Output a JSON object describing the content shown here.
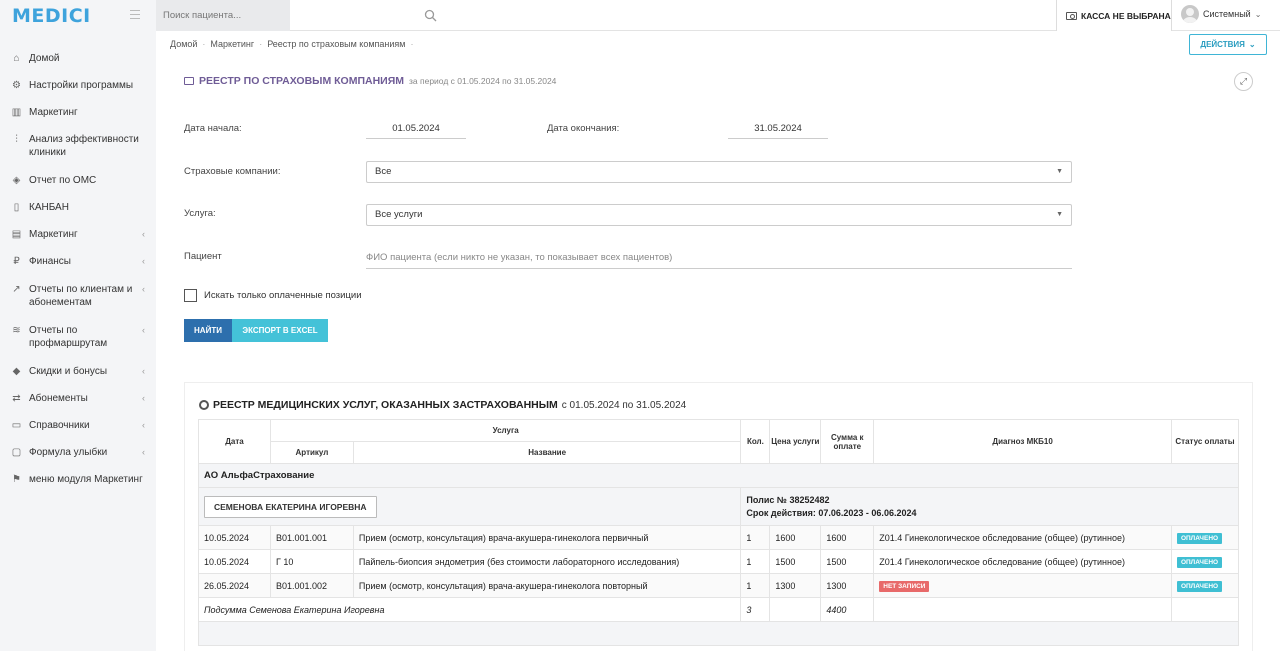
{
  "app": {
    "logo": "MEDICI"
  },
  "search": {
    "placeholder": "Поиск пациента..."
  },
  "kassa": {
    "label": "КАССА НЕ ВЫБРАНА"
  },
  "user": {
    "name": "Системный"
  },
  "sidebar": {
    "items": [
      {
        "label": "Домой",
        "icon": "home-icon",
        "arrow": false
      },
      {
        "label": "Настройки программы",
        "icon": "gear-icon",
        "arrow": false
      },
      {
        "label": "Маркетинг",
        "icon": "chart-icon",
        "arrow": false
      },
      {
        "label": "Анализ эффективности клиники",
        "icon": "sliders-icon",
        "arrow": false
      },
      {
        "label": "Отчет по ОМС",
        "icon": "shield-icon",
        "arrow": false
      },
      {
        "label": "КАНБАН",
        "icon": "columns-icon",
        "arrow": false
      },
      {
        "label": "Маркетинг",
        "icon": "bar-chart-icon",
        "arrow": true
      },
      {
        "label": "Финансы",
        "icon": "ruble-icon",
        "arrow": true
      },
      {
        "label": "Отчеты по клиентам и абонементам",
        "icon": "line-chart-icon",
        "arrow": true
      },
      {
        "label": "Отчеты по профмаршрутам",
        "icon": "layers-icon",
        "arrow": true
      },
      {
        "label": "Скидки и бонусы",
        "icon": "tag-icon",
        "arrow": true
      },
      {
        "label": "Абонементы",
        "icon": "ticket-icon",
        "arrow": true
      },
      {
        "label": "Справочники",
        "icon": "book-icon",
        "arrow": true
      },
      {
        "label": "Формула улыбки",
        "icon": "chat-icon",
        "arrow": true
      },
      {
        "label": "меню модуля Маркетинг",
        "icon": "signpost-icon",
        "arrow": false
      }
    ]
  },
  "breadcrumb": {
    "home": "Домой",
    "marketing": "Маркетинг",
    "current": "Реестр по страховым компаниям"
  },
  "actions": {
    "label": "ДЕЙСТВИЯ"
  },
  "panel": {
    "title": "РЕЕСТР ПО СТРАХОВЫМ КОМПАНИЯМ",
    "subtitle": "за период с 01.05.2024 по 31.05.2024"
  },
  "form": {
    "start_label": "Дата начала:",
    "start_value": "01.05.2024",
    "end_label": "Дата окончания:",
    "end_value": "31.05.2024",
    "insurers_label": "Страховые компании:",
    "insurers_value": "Все",
    "service_label": "Услуга:",
    "service_value": "Все услуги",
    "patient_label": "Пациент",
    "patient_placeholder": "ФИО пациента (если никто не указан, то показывает всех пациентов)",
    "paid_only_label": "Искать только оплаченные позиции",
    "find_button": "НАЙТИ",
    "excel_button": "ЭКСПОРТ В EXCEL"
  },
  "report": {
    "title": "РЕЕСТР МЕДИЦИНСКИХ УСЛУГ, ОКАЗАННЫХ ЗАСТРАХОВАННЫМ",
    "period": "с 01.05.2024 по 31.05.2024",
    "headers": {
      "date": "Дата",
      "service": "Услуга",
      "article": "Артикул",
      "name": "Название",
      "qty": "Кол.",
      "price": "Цена услуги",
      "sum": "Сумма к оплате",
      "diagnosis": "Диагноз МКБ10",
      "status": "Статус оплаты"
    },
    "company": "АО АльфаСтрахование",
    "patient": {
      "name": "СЕМЕНОВА ЕКАТЕРИНА ИГОРЕВНА",
      "polis": "Полис № 38252482",
      "validity": "Срок действия: 07.06.2023 - 06.06.2024"
    },
    "rows": [
      {
        "date": "10.05.2024",
        "article": "B01.001.001",
        "name": "Прием (осмотр, консультация) врача-акушера-гинеколога первичный",
        "qty": "1",
        "price": "1600",
        "sum": "1600",
        "diagnosis": "Z01.4 Гинекологическое обследование (общее) (рутинное)",
        "diag_badge": "",
        "status": "ОПЛАЧЕНО"
      },
      {
        "date": "10.05.2024",
        "article": "Г 10",
        "name": "Пайпель-биопсия эндометрия (без стоимости лабораторного исследования)",
        "qty": "1",
        "price": "1500",
        "sum": "1500",
        "diagnosis": "Z01.4 Гинекологическое обследование (общее) (рутинное)",
        "diag_badge": "",
        "status": "ОПЛАЧЕНО"
      },
      {
        "date": "26.05.2024",
        "article": "B01.001.002",
        "name": "Прием (осмотр, консультация) врача-акушера-гинеколога повторный",
        "qty": "1",
        "price": "1300",
        "sum": "1300",
        "diagnosis": "",
        "diag_badge": "НЕТ ЗАПИСИ",
        "status": "ОПЛАЧЕНО"
      }
    ],
    "subtotal": {
      "label": "Подсумма Семенова Екатерина Игоревна",
      "qty": "3",
      "sum": "4400"
    }
  },
  "colors": {
    "brand": "#3ea3dc",
    "primary": "#2d6fad",
    "accent": "#44c2d8",
    "title": "#6f5c96",
    "danger": "#e86a6a"
  }
}
